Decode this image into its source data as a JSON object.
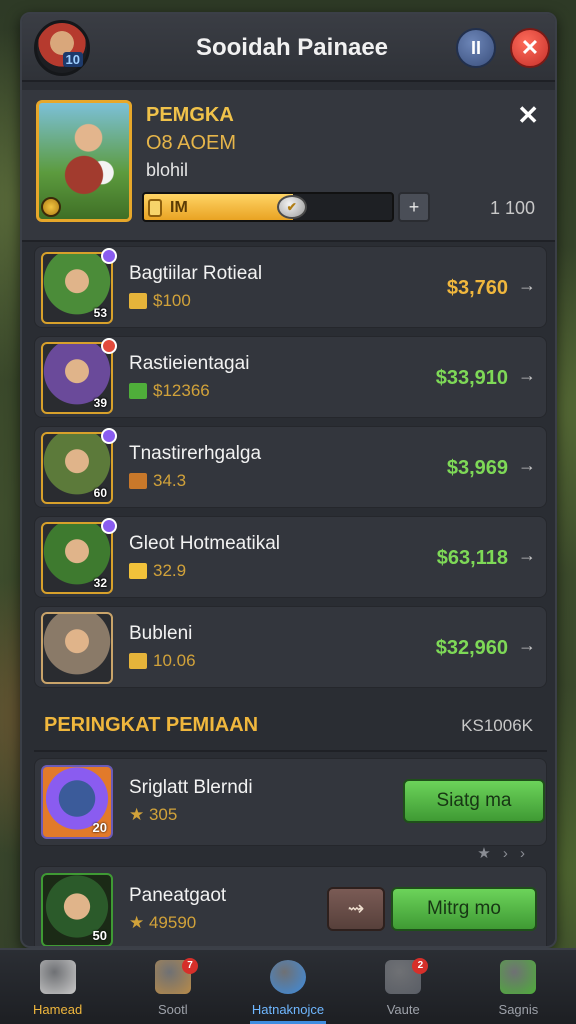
{
  "header": {
    "title": "Sooidah Painaee",
    "avatar_level": "10",
    "pause_label": "II",
    "close_label": "✕"
  },
  "featured": {
    "title": "PEMGKA",
    "subtitle": "O8 AOEM",
    "note": "blohil",
    "bar_label": "IM",
    "bar_fill": 0.6,
    "plus_label": "+",
    "max_value": "1 100",
    "dismiss": "✕"
  },
  "list": [
    {
      "name": "Bagtiilar Rotieal",
      "sub": "$100",
      "price": "$3,760",
      "price_color": "#f0b73d",
      "level": "53",
      "dot_color": "#8a5cf0",
      "sub_icon": "gold-bar-icon",
      "thumb_color": "#4b8c39"
    },
    {
      "name": "Rastieientagai",
      "sub": "$12366",
      "price": "$33,910",
      "price_color": "#7ed957",
      "level": "39",
      "dot_color": "#e34a3c",
      "sub_icon": "cash-icon",
      "thumb_color": "#6a4a9a"
    },
    {
      "name": "Tnastirerhgalga",
      "sub": "34.3",
      "price": "$3,969",
      "price_color": "#7ed957",
      "level": "60",
      "dot_color": "#8a5cf0",
      "sub_icon": "house-icon",
      "thumb_color": "#5c7a3a"
    },
    {
      "name": "Gleot Hotmeatikal",
      "sub": "32.9",
      "price": "$63,118",
      "price_color": "#7ed957",
      "level": "32",
      "dot_color": "#8a5cf0",
      "sub_icon": "star-icon",
      "thumb_color": "#3e7a2f"
    },
    {
      "name": "Bubleni",
      "sub": "10.06",
      "price": "$32,960",
      "price_color": "#7ed957",
      "level": "",
      "dot_color": "",
      "sub_icon": "gold-bar-icon",
      "thumb_color": "#8a7a68"
    }
  ],
  "ranking": {
    "title": "PERINGKAT PEMIAAN",
    "meta": "KS1006K",
    "pager": "★ › ›",
    "rows": [
      {
        "name": "Sriglatt Blerndi",
        "sub": "★ 305",
        "level": "20",
        "button": "Siatg ma"
      },
      {
        "name": "Paneatgaot",
        "sub": "★ 49590",
        "level": "50",
        "button": "Mitrg mo",
        "secondary": "⇝"
      }
    ]
  },
  "tabs": [
    {
      "label": "Hamead",
      "icon": "home-icon",
      "badge": ""
    },
    {
      "label": "Sootl",
      "icon": "shop-icon",
      "badge": "7"
    },
    {
      "label": "Hatnaknojce",
      "icon": "compass-icon",
      "badge": ""
    },
    {
      "label": "Vaute",
      "icon": "shield-icon",
      "badge": "2"
    },
    {
      "label": "Sagnis",
      "icon": "cash-stack-icon",
      "badge": ""
    }
  ]
}
